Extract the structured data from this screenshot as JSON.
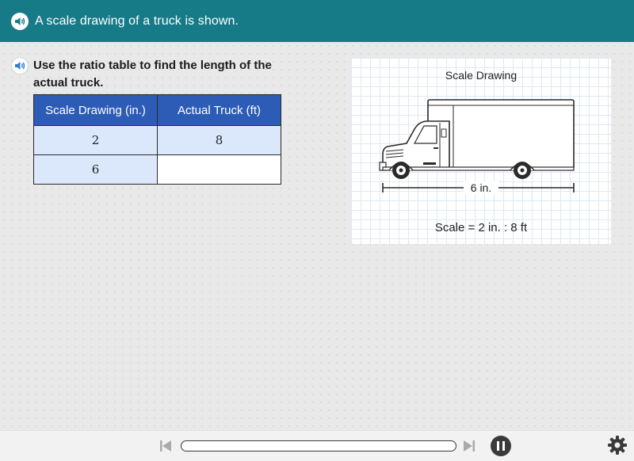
{
  "header": {
    "text": "A scale drawing of a truck is shown.",
    "icon": "speaker-icon"
  },
  "question": {
    "text": "Use the ratio table to find the length of the actual truck.",
    "icon": "speaker-icon"
  },
  "ratio_table": {
    "headers": [
      "Scale Drawing (in.)",
      "Actual Truck (ft)"
    ],
    "rows": [
      [
        "2",
        "8"
      ],
      [
        "6",
        ""
      ]
    ]
  },
  "drawing": {
    "title": "Scale Drawing",
    "dimension_label": "6 in.",
    "scale_text": "Scale = 2 in. : 8 ft"
  },
  "footer": {
    "icons": [
      "skip-back-icon",
      "skip-forward-icon",
      "pause-icon",
      "gear-icon"
    ],
    "progress": 0
  },
  "colors": {
    "header_bg": "#177a87",
    "table_header_bg": "#2d5cb7",
    "table_row_blue": "#dbe8fb"
  }
}
